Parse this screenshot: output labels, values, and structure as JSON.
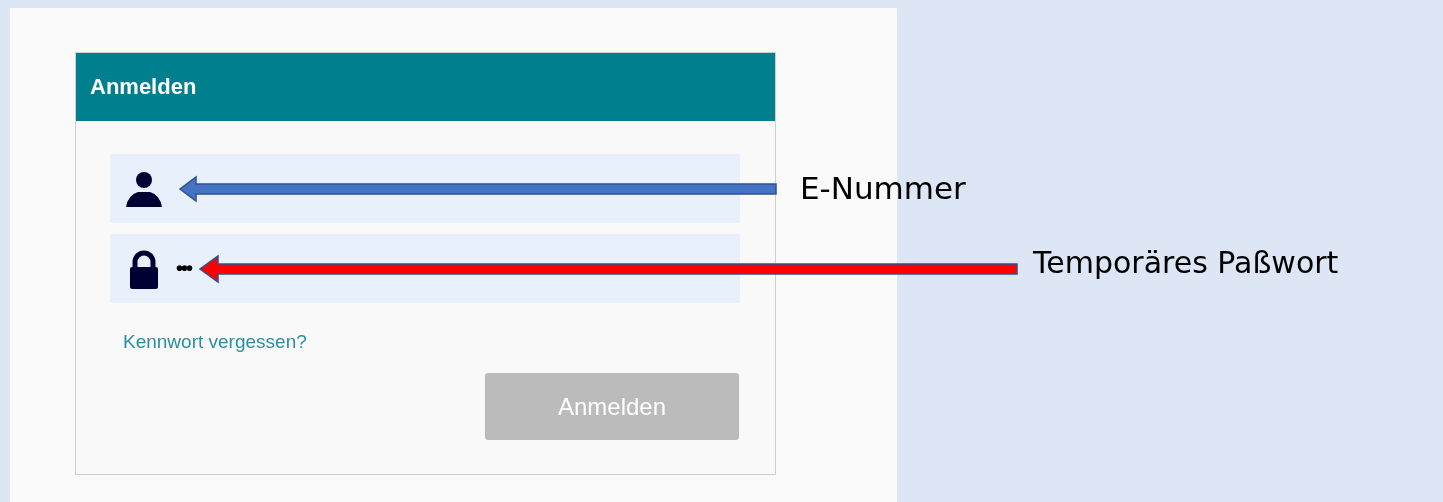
{
  "login_card": {
    "title": "Anmelden",
    "password_field": {
      "value": "•••"
    },
    "forgot_link": "Kennwort vergessen?",
    "submit_button": {
      "label": "Anmelden",
      "disabled": true
    }
  },
  "annotations": [
    {
      "label": "E-Nummer",
      "color": "#4472c4"
    },
    {
      "label": "Temporäres Paßwort",
      "color": "#ff0000"
    }
  ]
}
